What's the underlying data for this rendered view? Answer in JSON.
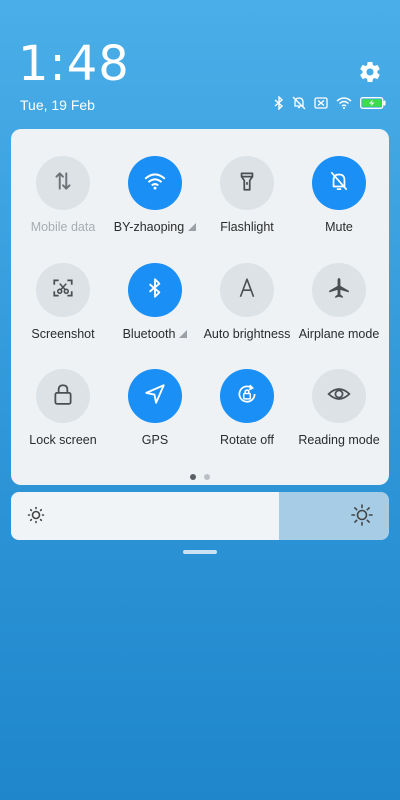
{
  "status": {
    "time": "1:48",
    "date": "Tue, 19 Feb",
    "icons": [
      "bluetooth-icon",
      "mute-icon",
      "no-sim-icon",
      "wifi-icon",
      "battery-charging-icon"
    ]
  },
  "tiles": [
    {
      "label": "Mobile data",
      "icon": "mobile-data-icon",
      "on": false,
      "dim": true
    },
    {
      "label": "BY-zhaoping",
      "icon": "wifi-icon",
      "on": true,
      "expand": true
    },
    {
      "label": "Flashlight",
      "icon": "flashlight-icon",
      "on": false
    },
    {
      "label": "Mute",
      "icon": "mute-icon",
      "on": true
    },
    {
      "label": "Screenshot",
      "icon": "screenshot-icon",
      "on": false
    },
    {
      "label": "Bluetooth",
      "icon": "bluetooth-icon",
      "on": true,
      "expand": true
    },
    {
      "label": "Auto brightness",
      "icon": "auto-brightness-icon",
      "on": false
    },
    {
      "label": "Airplane mode",
      "icon": "airplane-icon",
      "on": false
    },
    {
      "label": "Lock screen",
      "icon": "lock-icon",
      "on": false
    },
    {
      "label": "GPS",
      "icon": "gps-icon",
      "on": true
    },
    {
      "label": "Rotate off",
      "icon": "rotate-lock-icon",
      "on": true
    },
    {
      "label": "Reading mode",
      "icon": "eye-icon",
      "on": false
    }
  ],
  "pager": {
    "pages": 2,
    "active": 0
  },
  "brightness": {
    "level": 0.71
  },
  "colors": {
    "accent": "#1a8ff5",
    "tile_off": "#dde2e6",
    "panel": "#eef2f5",
    "background": "#2f96d8"
  }
}
